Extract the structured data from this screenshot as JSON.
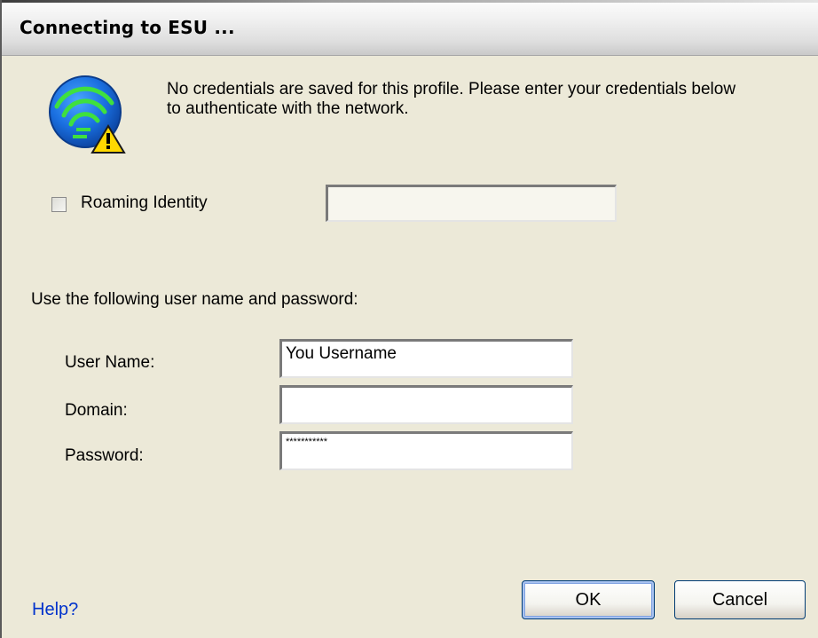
{
  "window": {
    "title": "Connecting to ESU ..."
  },
  "message": {
    "line1": "No credentials are saved for this profile. Please enter your credentials below",
    "line2": "to authenticate with the network."
  },
  "roaming": {
    "checkbox_label": "Roaming Identity",
    "checked": false,
    "value": ""
  },
  "section_label": "Use the following user name and password:",
  "fields": {
    "username_label": "User Name:",
    "username_value": "You Username",
    "domain_label": "Domain:",
    "domain_value": "",
    "password_label": "Password:",
    "password_value": "***********"
  },
  "buttons": {
    "ok": "OK",
    "cancel": "Cancel"
  },
  "help_link": "Help?",
  "icon": "wireless-network-warning-icon"
}
